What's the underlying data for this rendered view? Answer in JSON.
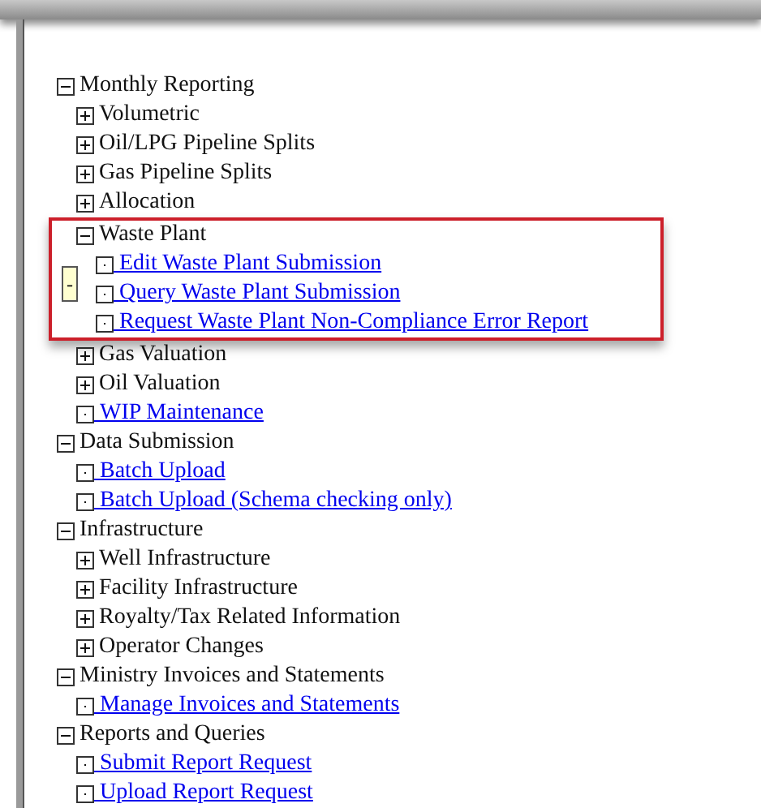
{
  "tree": [
    {
      "label": "Monthly Reporting",
      "kind": "folder",
      "expanded": true,
      "children": [
        {
          "label": "Volumetric",
          "kind": "folder",
          "expanded": false
        },
        {
          "label": "Oil/LPG Pipeline Splits",
          "kind": "folder",
          "expanded": false
        },
        {
          "label": "Gas Pipeline Splits",
          "kind": "folder",
          "expanded": false
        },
        {
          "label": "Allocation",
          "kind": "folder",
          "expanded": false
        },
        {
          "label": "Waste Plant",
          "kind": "folder",
          "expanded": true,
          "highlighted": true,
          "tooltip": "-",
          "children": [
            {
              "label": "Edit Waste Plant Submission",
              "kind": "link"
            },
            {
              "label": "Query Waste Plant Submission",
              "kind": "link"
            },
            {
              "label": "Request Waste Plant Non-Compliance Error Report",
              "kind": "link"
            }
          ]
        },
        {
          "label": "Gas Valuation",
          "kind": "folder",
          "expanded": false
        },
        {
          "label": "Oil Valuation",
          "kind": "folder",
          "expanded": false
        },
        {
          "label": "WIP Maintenance",
          "kind": "link"
        }
      ]
    },
    {
      "label": "Data Submission",
      "kind": "folder",
      "expanded": true,
      "children": [
        {
          "label": "Batch Upload",
          "kind": "link"
        },
        {
          "label": "Batch Upload (Schema checking only)",
          "kind": "link"
        }
      ]
    },
    {
      "label": "Infrastructure",
      "kind": "folder",
      "expanded": true,
      "children": [
        {
          "label": "Well Infrastructure",
          "kind": "folder",
          "expanded": false
        },
        {
          "label": "Facility Infrastructure",
          "kind": "folder",
          "expanded": false
        },
        {
          "label": "Royalty/Tax Related Information",
          "kind": "folder",
          "expanded": false
        },
        {
          "label": "Operator Changes",
          "kind": "folder",
          "expanded": false
        }
      ]
    },
    {
      "label": "Ministry Invoices and Statements",
      "kind": "folder",
      "expanded": true,
      "children": [
        {
          "label": "Manage Invoices and Statements",
          "kind": "link"
        }
      ]
    },
    {
      "label": "Reports and Queries",
      "kind": "folder",
      "expanded": true,
      "children": [
        {
          "label": "Submit Report Request",
          "kind": "link"
        },
        {
          "label": "Upload Report Request",
          "kind": "link"
        }
      ]
    }
  ]
}
